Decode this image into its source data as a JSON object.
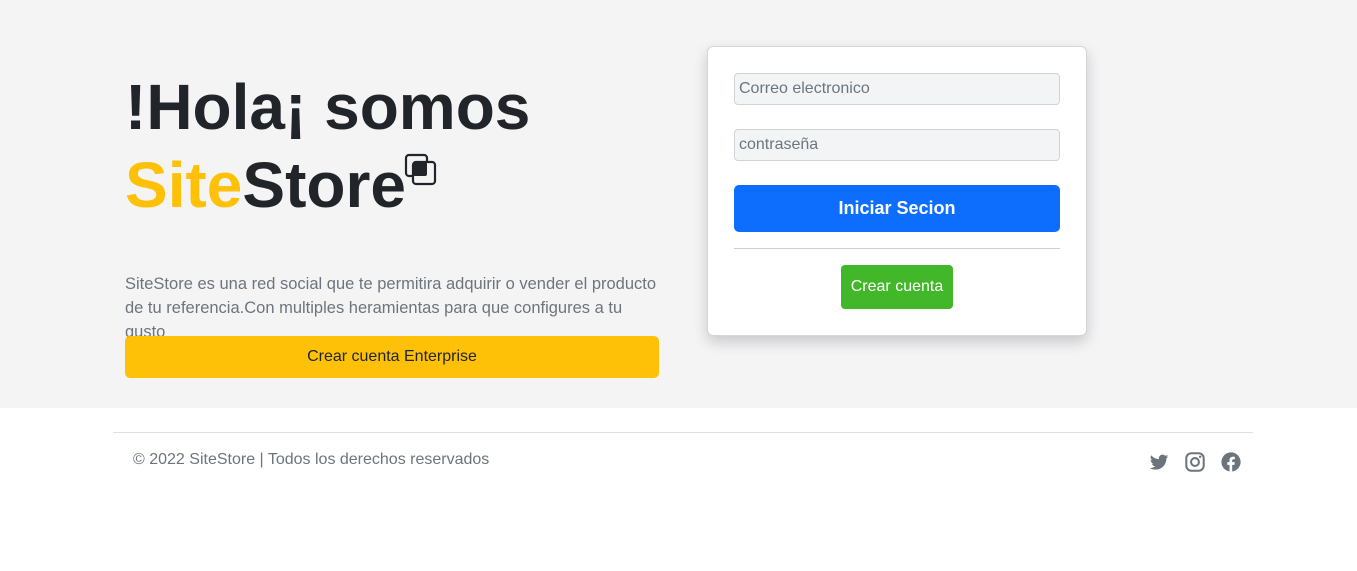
{
  "hero": {
    "headline_line1": "!Hola¡ somos",
    "brand_accent": "Site",
    "brand_rest": "Store",
    "description": "SiteStore es una red social que te permitira adquirir o vender el producto de tu referencia.Con multiples heramientas para que configures a tu gusto",
    "enterprise_button": "Crear cuenta Enterprise",
    "logo_icon": "stacked-squares-icon"
  },
  "login": {
    "email_placeholder": "Correo electronico",
    "password_placeholder": "contraseña",
    "login_button": "Iniciar Secion",
    "create_button": "Crear cuenta"
  },
  "footer": {
    "copyright": "© 2022 SiteStore | Todos los derechos reservados",
    "social_icons": [
      "twitter-icon",
      "instagram-icon",
      "facebook-icon"
    ]
  },
  "colors": {
    "accent": "#ffc107",
    "primary": "#0d6efd",
    "success": "#42b72a",
    "hero_background": "#f4f4f5"
  }
}
